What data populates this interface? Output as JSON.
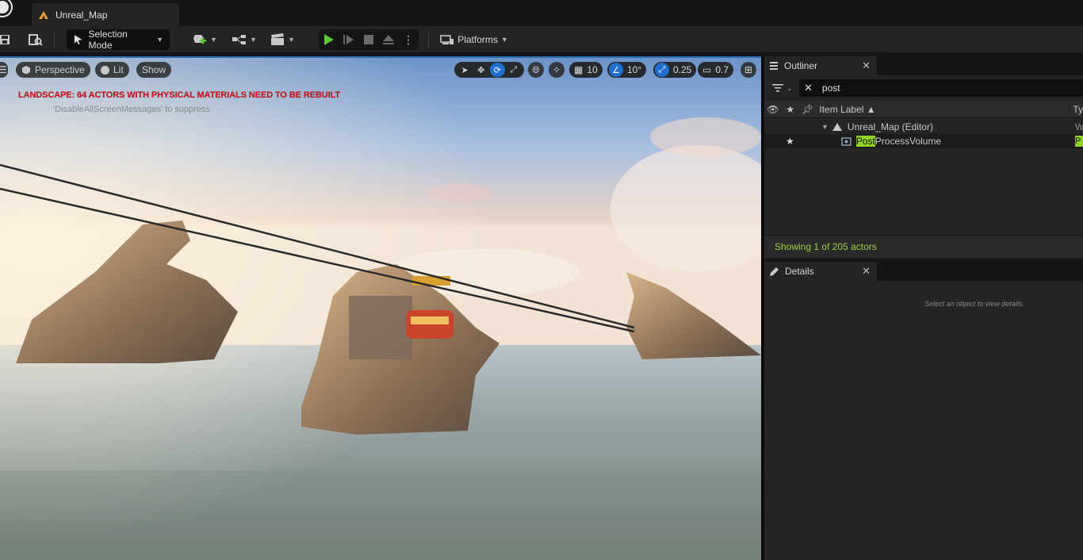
{
  "window": {
    "map_tab": "Unreal_Map"
  },
  "toolbar": {
    "mode_label": "Selection Mode",
    "platforms_label": "Platforms"
  },
  "viewport": {
    "perspective_label": "Perspective",
    "lit_label": "Lit",
    "show_label": "Show",
    "grid_snap": "10",
    "rotation_snap": "10°",
    "scale_snap": "0.25",
    "camera_speed": "0.7",
    "warning": "LANDSCAPE: 64 ACTORS WITH PHYSICAL MATERIALS NEED TO BE REBUILT",
    "suppress_hint": "'DisableAllScreenMessages' to suppress",
    "active_tool": "rotate"
  },
  "outliner": {
    "tab_label": "Outliner",
    "search_value": "post",
    "column_label": "Item Label",
    "column_type": "Ty",
    "rows": [
      {
        "label": "Unreal_Map (Editor)",
        "type": "W"
      },
      {
        "label_highlight": "Post",
        "label_rest": "ProcessVolume",
        "type": "P"
      }
    ],
    "status": "Showing 1 of 205 actors"
  },
  "details": {
    "tab_label": "Details",
    "empty_message": "Select an object to view details."
  },
  "colors": {
    "accent_blue": "#1f6fd1",
    "play_green": "#5cc93a",
    "search_highlight": "#8ed428",
    "warning_red": "#c8141e"
  }
}
